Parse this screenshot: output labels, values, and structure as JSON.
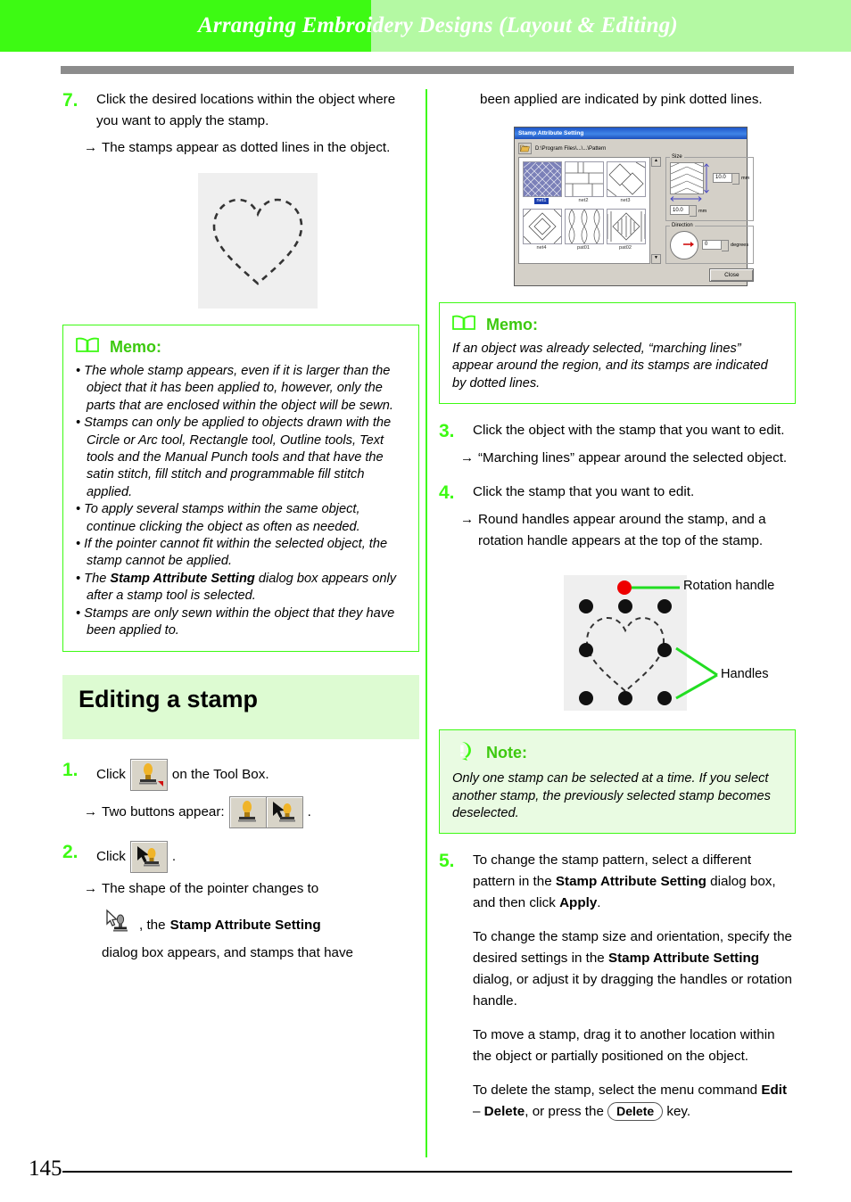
{
  "header": {
    "title": "Arranging Embroidery Designs (Layout & Editing)",
    "accent_bright": "#3dfa13",
    "accent_light": "#b4f9a3",
    "rule_color": "#8c8c8c"
  },
  "page_number": "145",
  "left_column": {
    "step7": {
      "number": "7.",
      "text": "Click the desired locations within the object where you want to apply the stamp.",
      "result_arrow": "→",
      "result": "The stamps appear as dotted lines in the object."
    },
    "heart_figure_caption": "",
    "memo": {
      "icon": "book-icon",
      "label": "Memo:",
      "bullets": [
        "The whole stamp appears, even if it is larger than the object that it has been applied to, however, only the parts that are enclosed within the object will be sewn.",
        "Stamps can only be applied to objects drawn with the Circle or Arc tool, Rectangle tool, Outline tools, Text tools and the Manual Punch tools and that have the satin stitch, fill stitch and programmable fill stitch applied.",
        "To apply several stamps within the same object, continue clicking the object as often as needed.",
        "If the pointer cannot fit within the selected object, the stamp cannot be applied.",
        "The Stamp Attribute Setting dialog box appears only after a stamp tool is selected.",
        "Stamps are only sewn within the object that they have been applied to."
      ],
      "bullet5_bold": "Stamp Attribute Setting"
    },
    "section_heading": "Editing a stamp",
    "step1": {
      "number": "1.",
      "text_before": "Click",
      "text_after": "on the Tool Box.",
      "result_arrow": "→",
      "result_before": "Two buttons appear:",
      "result_after": "."
    },
    "step2": {
      "number": "2.",
      "text_before": "Click",
      "text_after": ".",
      "result_arrow": "→",
      "result_line1": "The shape of the pointer changes to",
      "result_line2_before": ", the",
      "result_line2_bold": "Stamp Attribute Setting",
      "result_line3": "dialog box appears, and stamps that have"
    }
  },
  "right_column": {
    "continued_text": "been applied are indicated by pink dotted lines.",
    "dialog": {
      "title": "Stamp Attribute Setting",
      "path": "D:\\Program Files\\...\\...\\Pattern",
      "patterns": [
        {
          "label": "net1",
          "selected": true
        },
        {
          "label": "net2",
          "selected": false
        },
        {
          "label": "net3",
          "selected": false
        },
        {
          "label": "net4",
          "selected": false
        },
        {
          "label": "pat01",
          "selected": false
        },
        {
          "label": "pat02",
          "selected": false
        }
      ],
      "size_group": "Size",
      "size_height": "10.0",
      "size_width": "10.0",
      "size_unit": "mm",
      "direction_group": "Direction",
      "direction_value": "0",
      "direction_unit": "degrees",
      "close_button": "Close",
      "scroll_up": "▲",
      "scroll_down": "▼"
    },
    "memo": {
      "icon": "book-icon",
      "label": "Memo:",
      "text": "If an object was already selected, “marching lines” appear around the region, and its stamps are indicated by dotted lines."
    },
    "step3": {
      "number": "3.",
      "text": "Click the object with the stamp that you want to edit.",
      "result_arrow": "→",
      "result": "“Marching lines” appear around the selected object."
    },
    "step4": {
      "number": "4.",
      "text": "Click the stamp that you want to edit.",
      "result_arrow": "→",
      "result": "Round handles appear around the stamp, and a rotation handle appears at the top of the stamp."
    },
    "figure": {
      "rotation_label": "Rotation handle",
      "handles_label": "Handles",
      "rotation_handle_color": "#ee0000",
      "handle_color": "#111111",
      "leader_color": "#22dd22",
      "canvas_color": "#efefef"
    },
    "note": {
      "icon": "exclamation-icon",
      "label": "Note:",
      "text": "Only one stamp can be selected at a time. If you select another stamp, the previously selected stamp becomes deselected."
    },
    "step5": {
      "number": "5.",
      "p1_a": "To change the stamp pattern, select a different pattern in the ",
      "p1_b": "Stamp Attribute Setting",
      "p1_c": " dialog box, and then click ",
      "p1_d": "Apply",
      "p1_e": ".",
      "p2_a": "To change the stamp size and orientation, specify the desired settings in the ",
      "p2_b": "Stamp Attribute Setting",
      "p2_c": " dialog, or adjust it by dragging the handles or rotation handle.",
      "p3": "To move a stamp, drag it to another location within the object or partially positioned on the object.",
      "p4_a": "To delete the stamp, select the menu command ",
      "p4_b": "Edit",
      "p4_c": " – ",
      "p4_d": "Delete",
      "p4_e": ", or press the ",
      "p4_key": "Delete",
      "p4_f": " key."
    }
  }
}
